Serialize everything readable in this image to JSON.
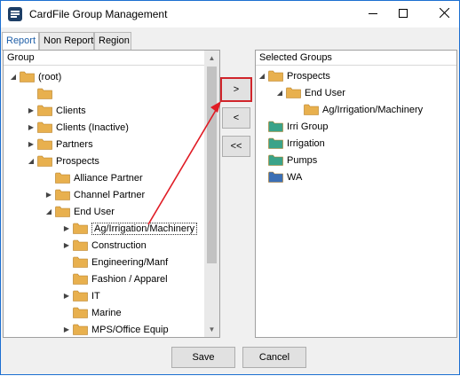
{
  "window": {
    "title": "CardFile Group Management",
    "minimize_icon": "minimize-icon",
    "maximize_icon": "maximize-icon",
    "close_icon": "close-icon"
  },
  "tabs": [
    {
      "label": "Report",
      "active": true
    },
    {
      "label": "Non Report",
      "active": false
    },
    {
      "label": "Region",
      "active": false
    }
  ],
  "left_panel": {
    "header": "Group",
    "tree": [
      {
        "label": "(root)",
        "level": 0,
        "expanded": true,
        "color": "#e8b04e"
      },
      {
        "label": "",
        "level": 1,
        "expanded": null,
        "color": "#e8b04e"
      },
      {
        "label": "Clients",
        "level": 1,
        "expanded": false,
        "color": "#e8b04e"
      },
      {
        "label": "Clients (Inactive)",
        "level": 1,
        "expanded": false,
        "color": "#e8b04e"
      },
      {
        "label": "Partners",
        "level": 1,
        "expanded": false,
        "color": "#e8b04e"
      },
      {
        "label": "Prospects",
        "level": 1,
        "expanded": true,
        "color": "#e8b04e"
      },
      {
        "label": "Alliance Partner",
        "level": 2,
        "expanded": null,
        "color": "#e8b04e"
      },
      {
        "label": "Channel Partner",
        "level": 2,
        "expanded": false,
        "color": "#e8b04e"
      },
      {
        "label": "End User",
        "level": 2,
        "expanded": true,
        "color": "#e8b04e"
      },
      {
        "label": "Ag/Irrigation/Machinery",
        "level": 3,
        "expanded": false,
        "color": "#e8b04e",
        "selected": true
      },
      {
        "label": "Construction",
        "level": 3,
        "expanded": false,
        "color": "#e8b04e"
      },
      {
        "label": "Engineering/Manf",
        "level": 3,
        "expanded": null,
        "color": "#e8b04e"
      },
      {
        "label": "Fashion / Apparel",
        "level": 3,
        "expanded": null,
        "color": "#e8b04e"
      },
      {
        "label": "IT",
        "level": 3,
        "expanded": false,
        "color": "#e8b04e"
      },
      {
        "label": "Marine",
        "level": 3,
        "expanded": null,
        "color": "#e8b04e"
      },
      {
        "label": "MPS/Office Equip",
        "level": 3,
        "expanded": false,
        "color": "#e8b04e"
      }
    ]
  },
  "right_panel": {
    "header": "Selected Groups",
    "tree": [
      {
        "label": "Prospects",
        "level": 0,
        "expanded": true,
        "color": "#e8b04e"
      },
      {
        "label": "End User",
        "level": 1,
        "expanded": true,
        "color": "#e8b04e"
      },
      {
        "label": "Ag/Irrigation/Machinery",
        "level": 2,
        "expanded": null,
        "color": "#e8b04e"
      },
      {
        "label": "Irri Group",
        "level": 0,
        "expanded": null,
        "color": "#3aa389"
      },
      {
        "label": "Irrigation",
        "level": 0,
        "expanded": null,
        "color": "#3aa389"
      },
      {
        "label": "Pumps",
        "level": 0,
        "expanded": null,
        "color": "#3aa389"
      },
      {
        "label": "WA",
        "level": 0,
        "expanded": null,
        "color": "#3b6fb5"
      }
    ]
  },
  "move_buttons": {
    "add": ">",
    "remove": "<",
    "remove_all": "<<"
  },
  "footer": {
    "save": "Save",
    "cancel": "Cancel"
  },
  "annotation": {
    "arrow_color": "#e01b24",
    "highlight_color": "#d0252b"
  }
}
